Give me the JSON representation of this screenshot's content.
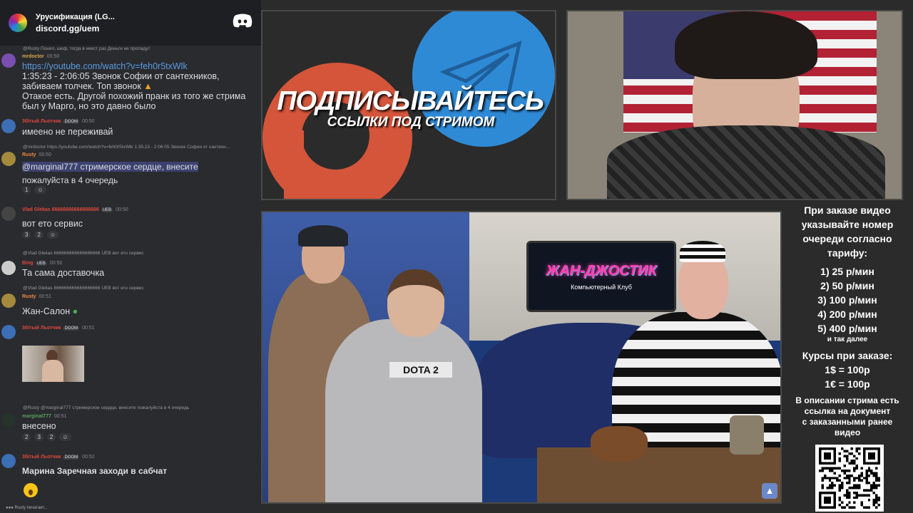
{
  "server": {
    "name": "Урусификация (LG...",
    "invite": "discord.gg/uem"
  },
  "messages": [
    {
      "reply": "@Rusty Понял, шеф, тогда в некст раз Деньги не пропадут",
      "name": "mrdoctor",
      "time": "00:50",
      "lines": [
        "https://youtube.com/watch?v=feh0r5txWlk",
        "1:35:23 - 2:06:05 Звонок Софии от сантехников,",
        "забиваем толчек. Топ звонок",
        "Отакое есть. Другой похожий пранк из того же стрима",
        "был у Марго, но это давно было"
      ]
    },
    {
      "reply": "",
      "name": "3бітый Льотчик",
      "badge": "DOOM",
      "time": "00:50",
      "lines": [
        "имеено не переживай"
      ]
    },
    {
      "reply": "@mrdoctor https://youtube.com/watch?v=feh0r5txWlk 1:35:23 - 2:06:05 Звонок Софии от сантехн...",
      "name": "Rusty",
      "time": "00:50",
      "lines": [
        "@marginal777 стримерское сердце, внесите",
        "пожалуйста в 4 очередь"
      ],
      "reactions": [
        "1",
        ""
      ]
    },
    {
      "reply": "",
      "name": "Vlad Glekas 66666666666666666",
      "badge": "UEB",
      "time": "00:50",
      "lines": [
        "вот ето сервис"
      ],
      "reactions": [
        "3",
        "2",
        ""
      ]
    },
    {
      "reply": "@Vlad Glekas 666666666666666666 UEB вот ето сервис",
      "name": "Bing",
      "badge": "UEB",
      "time": "00:50",
      "lines": [
        "Та сама доставочка"
      ]
    },
    {
      "reply": "@Vlad Glekas 666666666666666666 UEB вот ето сервис",
      "name": "Rusty",
      "time": "00:51",
      "lines": [
        "Жан-Салон"
      ]
    },
    {
      "reply": "",
      "name": "3бітый Льотчик",
      "badge": "DOOM",
      "time": "00:51",
      "lines": [
        ""
      ]
    },
    {
      "reply": "@Rusty @marginal777 стримерское сердце, внесите пожалуйста в 4 очередь",
      "name": "marginal777",
      "time": "00:51",
      "lines": [
        "внесено"
      ],
      "reactions": [
        "2",
        "3",
        "2",
        ""
      ]
    },
    {
      "reply": "",
      "name": "3бітый Льотчик",
      "badge": "DOOM",
      "time": "00:52",
      "lines": [
        "Марина Заречная заходи в сабчат"
      ]
    }
  ],
  "typing": "Rusty печатает...",
  "promo": {
    "title": "ПОДПИСЫВАЙТЕСЬ",
    "subtitle": "ССЫЛКИ ПОД СТРИМОМ"
  },
  "thumbnail": {
    "sign": "ЖАН-ДЖОСТИК",
    "sign_sub": "Компьютерный Клуб",
    "hoodie": "DOTA 2"
  },
  "info": {
    "intro": [
      "При заказе видео",
      "указывайте номер",
      "очереди согласно",
      "тарифу:"
    ],
    "tariffs": [
      "1) 25 р/мин",
      "2) 50 р/мин",
      "3) 100 р/мин",
      "4) 200 р/мин",
      "5) 400 р/мин"
    ],
    "etc": "и так далее",
    "courses_title": "Курсы при заказе:",
    "courses": [
      "1$ = 100р",
      "1€ = 100р"
    ],
    "desc": [
      "В описании стрима есть",
      "ссылка на документ",
      "с заказанными ранее",
      "видео"
    ]
  },
  "colors": {
    "chat_bg": "#2a2b2f",
    "link": "#5a9bdf",
    "accent_red": "#e0463a",
    "accent_orange": "#f0883e",
    "tg_blue": "#2f8ad6",
    "patreon_orange": "#d4553a"
  }
}
